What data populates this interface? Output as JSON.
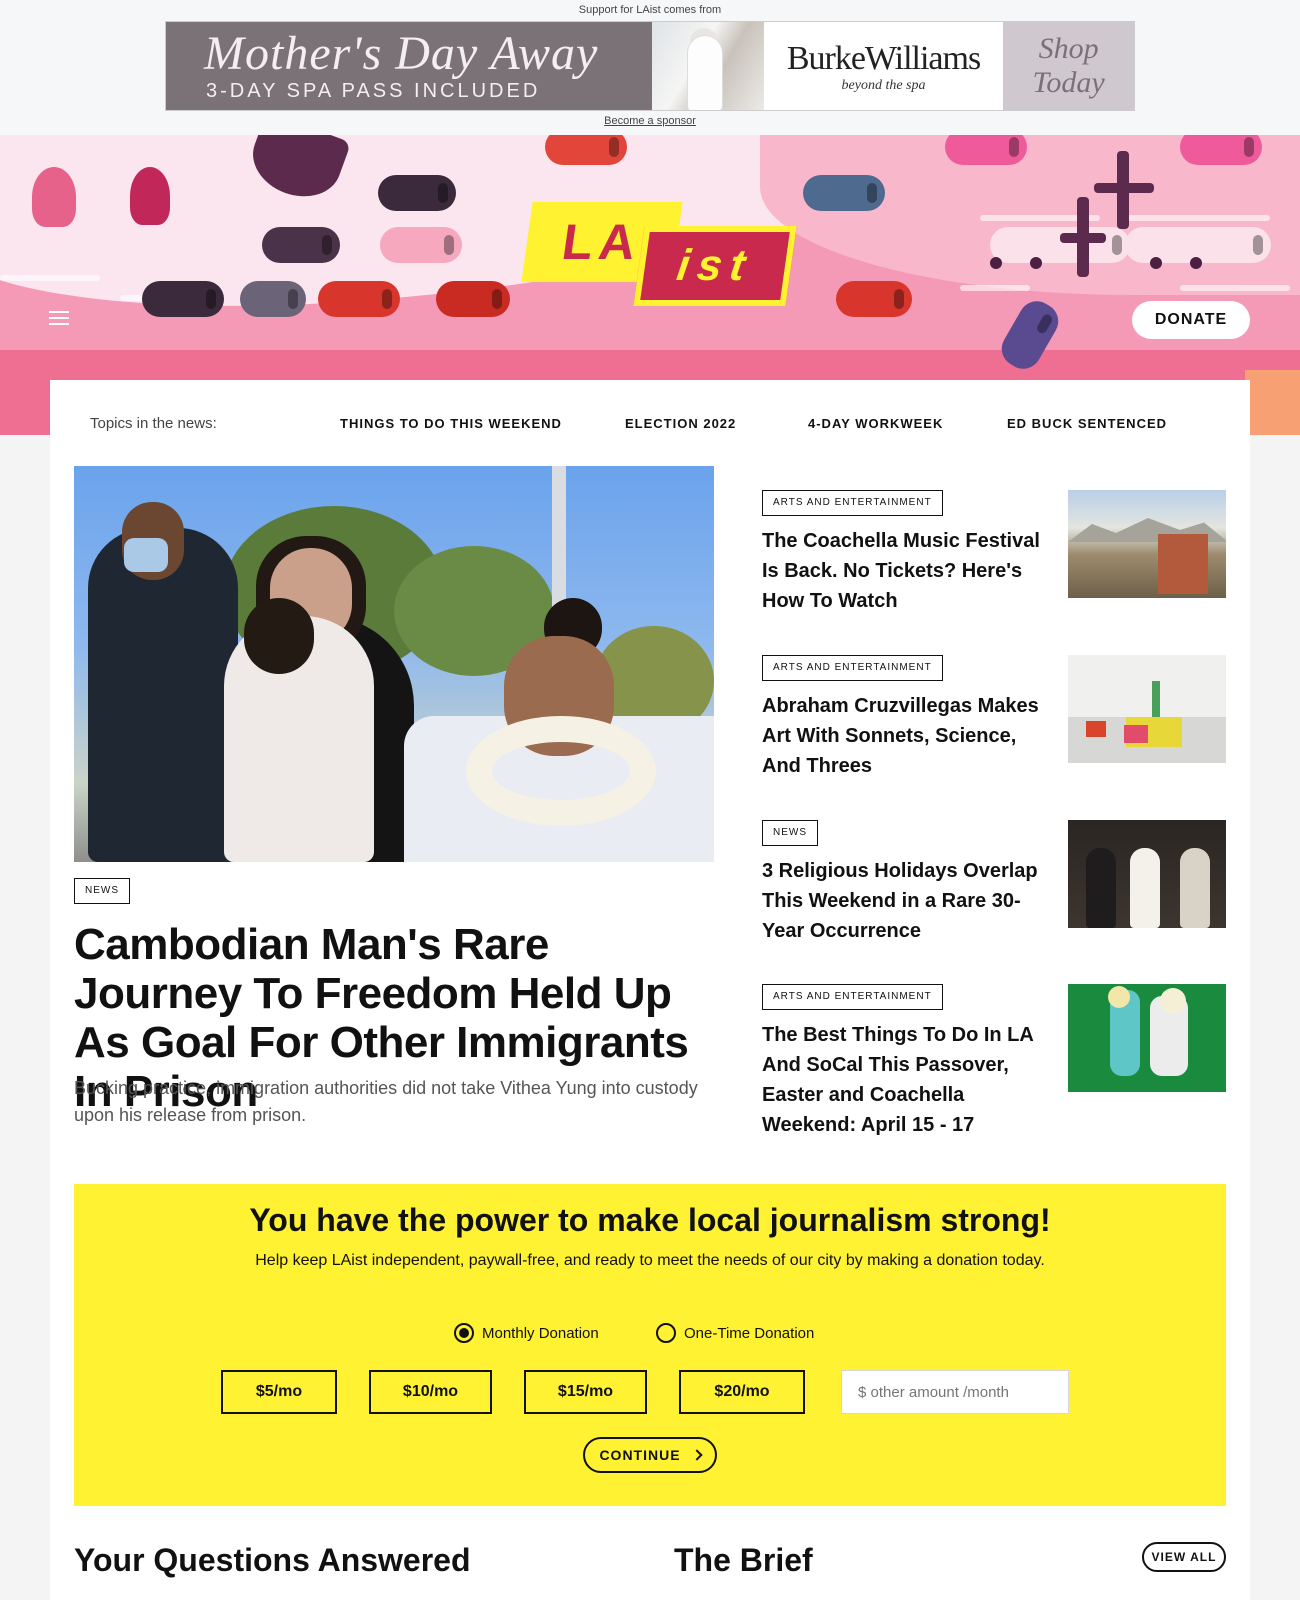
{
  "sponsor": {
    "label": "Support for LAist comes from",
    "become_link": "Become a sponsor",
    "ad": {
      "headline": "Mother's Day Away",
      "subline": "3-DAY SPA PASS INCLUDED",
      "brand": "BurkeWilliams",
      "brand_tagline": "beyond the spa",
      "cta": "Shop Today"
    }
  },
  "header": {
    "logo_la": "LA",
    "logo_ist": "ist",
    "donate_label": "DONATE"
  },
  "topics": {
    "label": "Topics in the news:",
    "items": [
      "THINGS TO DO THIS WEEKEND",
      "ELECTION 2022",
      "4-DAY WORKWEEK",
      "ED BUCK SENTENCED"
    ]
  },
  "lead": {
    "tag": "NEWS",
    "title": "Cambodian Man's Rare Journey To Freedom Held Up As Goal For Other Immigrants In Prison",
    "dek": "Bucking practice, immigration authorities did not take Vithea Yung into custody upon his release from prison."
  },
  "side_stories": [
    {
      "tag": "ARTS AND ENTERTAINMENT",
      "title": "The Coachella Music Festival Is Back. No Tickets? Here's How To Watch"
    },
    {
      "tag": "ARTS AND ENTERTAINMENT",
      "title": "Abraham Cruzvillegas Makes Art With Sonnets, Science, And Threes"
    },
    {
      "tag": "NEWS",
      "title": "3 Religious Holidays Overlap This Weekend in a Rare 30-Year Occurrence"
    },
    {
      "tag": "ARTS AND ENTERTAINMENT",
      "title": "The Best Things To Do In LA And SoCal This Passover, Easter and Coachella Weekend: April 15 - 17"
    }
  ],
  "donation": {
    "title": "You have the power to make local journalism strong!",
    "subtitle": "Help keep LAist independent, paywall-free, and ready to meet the needs of our city by making a donation today.",
    "options": {
      "monthly": "Monthly Donation",
      "one_time": "One-Time Donation",
      "selected": "monthly"
    },
    "amounts": [
      "$5/mo",
      "$10/mo",
      "$15/mo",
      "$20/mo"
    ],
    "other_placeholder": "$ other amount /month",
    "continue_label": "CONTINUE"
  },
  "sections": {
    "questions_title": "Your Questions Answered",
    "brief_title": "The Brief",
    "view_all_label": "VIEW ALL"
  },
  "colors": {
    "brand_yellow": "#fff233",
    "brand_red": "#c8294c",
    "hero_pink": "#f59ab6"
  }
}
